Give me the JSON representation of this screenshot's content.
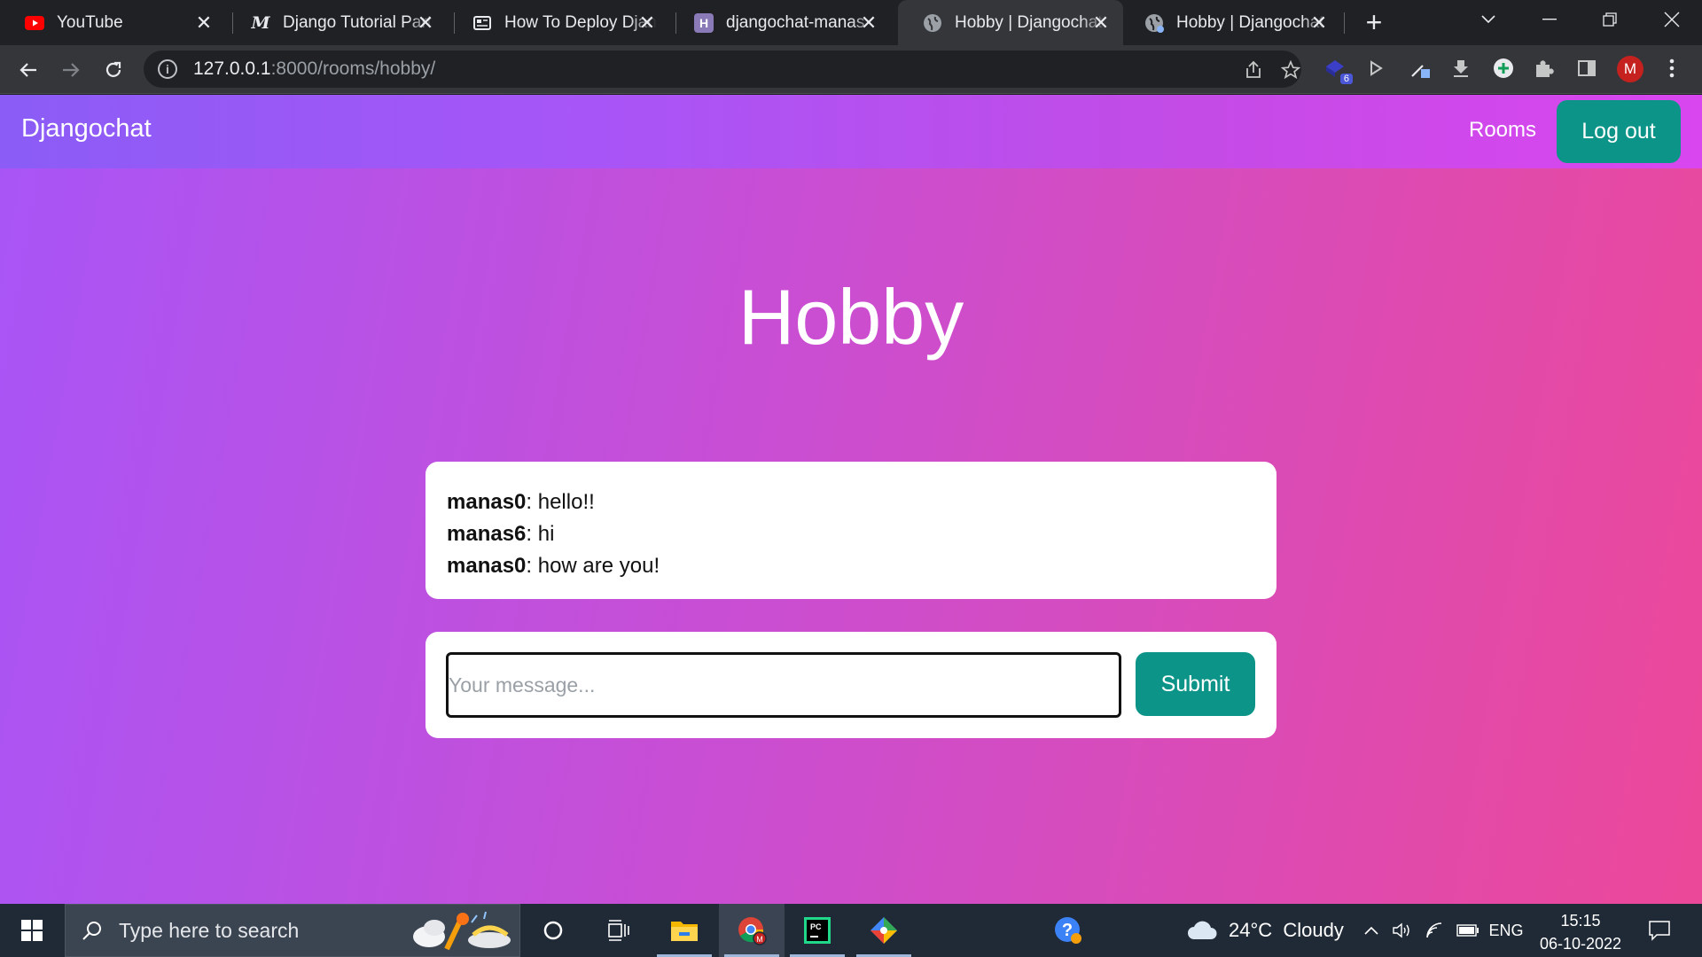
{
  "browser": {
    "tabs": [
      {
        "title": "YouTube",
        "icon": "youtube-icon"
      },
      {
        "title": "Django Tutorial Part",
        "icon": "medium-icon"
      },
      {
        "title": "How To Deploy Django",
        "icon": "article-icon"
      },
      {
        "title": "djangochat-manas",
        "icon": "heroku-icon"
      },
      {
        "title": "Hobby | Djangochat",
        "icon": "globe-icon",
        "active": true
      },
      {
        "title": "Hobby | Djangochat",
        "icon": "globe-icon"
      }
    ],
    "url_host": "127.0.0.1",
    "url_rest": ":8000/rooms/hobby/",
    "extension_badge": "6",
    "profile_initial": "M"
  },
  "app": {
    "brand": "Djangochat",
    "nav_rooms": "Rooms",
    "logout_label": "Log out",
    "room_name": "Hobby",
    "messages": [
      {
        "user": "manas0",
        "text": "hello!!"
      },
      {
        "user": "manas6",
        "text": "hi"
      },
      {
        "user": "manas0",
        "text": "how are you!"
      }
    ],
    "input_placeholder": "Your message...",
    "submit_label": "Submit"
  },
  "taskbar": {
    "search_placeholder": "Type here to search",
    "weather": "24°C  Cloudy",
    "language": "ENG",
    "time": "15:15",
    "date": "06-10-2022"
  },
  "colors": {
    "accent_button": "#0d9488",
    "gradient_start": "#a855f7",
    "gradient_end": "#ec4899"
  }
}
